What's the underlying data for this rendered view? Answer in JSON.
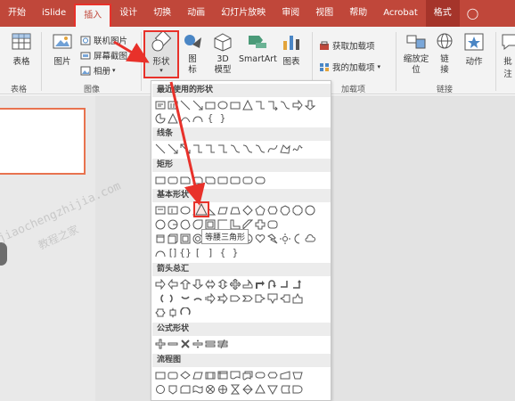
{
  "tabs": [
    {
      "label": "开始"
    },
    {
      "label": "iSlide"
    },
    {
      "label": "插入",
      "active": true
    },
    {
      "label": "设计"
    },
    {
      "label": "切换"
    },
    {
      "label": "动画"
    },
    {
      "label": "幻灯片放映"
    },
    {
      "label": "审阅"
    },
    {
      "label": "视图"
    },
    {
      "label": "帮助"
    },
    {
      "label": "Acrobat"
    },
    {
      "label": "格式",
      "contextual": true
    }
  ],
  "ribbon": {
    "table": {
      "label": "表格",
      "group": "表格"
    },
    "images": {
      "picture": "图片",
      "online_picture": "联机图片",
      "screenshot": "屏幕截图",
      "album": "相册",
      "group": "图像"
    },
    "illustrations": {
      "shapes": "形状",
      "icons": "图标",
      "models_3d": "3D 模型",
      "smartart": "SmartArt",
      "chart": "图表"
    },
    "addins": {
      "get": "获取加载项",
      "mine": "我的加载项",
      "group": "加载项"
    },
    "links": {
      "zoom": "缩放定位",
      "link": "链接",
      "action": "动作",
      "group": "链接"
    },
    "comments": {
      "label": "批注"
    }
  },
  "shapes_panel": {
    "sections": [
      {
        "title": "最近使用的形状"
      },
      {
        "title": "线条"
      },
      {
        "title": "矩形"
      },
      {
        "title": "基本形状"
      },
      {
        "title": "箭头总汇"
      },
      {
        "title": "公式形状"
      },
      {
        "title": "流程图"
      }
    ],
    "tooltip": "等腰三角形"
  },
  "watermark": {
    "line1": "jiaochengzhijia.com",
    "line2": "教程之家"
  },
  "colors": {
    "accent": "#c0473a",
    "highlight": "#e8312a"
  }
}
